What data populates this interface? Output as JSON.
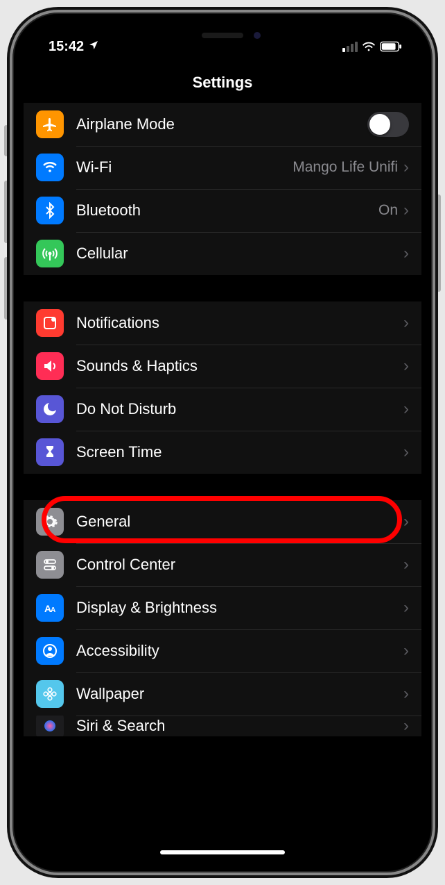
{
  "status": {
    "time": "15:42",
    "location_active": true,
    "cell_bars": 1,
    "wifi": true,
    "battery_pct": 85
  },
  "nav": {
    "title": "Settings"
  },
  "groups": [
    {
      "rows": [
        {
          "id": "airplane-mode",
          "icon": "airplane",
          "icon_bg": "#ff9500",
          "label": "Airplane Mode",
          "type": "toggle",
          "toggle_on": false
        },
        {
          "id": "wifi",
          "icon": "wifi",
          "icon_bg": "#007aff",
          "label": "Wi-Fi",
          "type": "nav",
          "value": "Mango Life Unifi"
        },
        {
          "id": "bluetooth",
          "icon": "bluetooth",
          "icon_bg": "#007aff",
          "label": "Bluetooth",
          "type": "nav",
          "value": "On"
        },
        {
          "id": "cellular",
          "icon": "antenna",
          "icon_bg": "#34c759",
          "label": "Cellular",
          "type": "nav"
        }
      ]
    },
    {
      "rows": [
        {
          "id": "notifications",
          "icon": "bell",
          "icon_bg": "#ff3b30",
          "label": "Notifications",
          "type": "nav"
        },
        {
          "id": "sounds",
          "icon": "speaker",
          "icon_bg": "#ff2d55",
          "label": "Sounds & Haptics",
          "type": "nav"
        },
        {
          "id": "dnd",
          "icon": "moon",
          "icon_bg": "#5856d6",
          "label": "Do Not Disturb",
          "type": "nav"
        },
        {
          "id": "screentime",
          "icon": "hourglass",
          "icon_bg": "#5856d6",
          "label": "Screen Time",
          "type": "nav"
        }
      ]
    },
    {
      "rows": [
        {
          "id": "general",
          "icon": "gear",
          "icon_bg": "#8e8e93",
          "label": "General",
          "type": "nav",
          "highlighted": true
        },
        {
          "id": "control-center",
          "icon": "switches",
          "icon_bg": "#8e8e93",
          "label": "Control Center",
          "type": "nav"
        },
        {
          "id": "display",
          "icon": "aa",
          "icon_bg": "#007aff",
          "label": "Display & Brightness",
          "type": "nav"
        },
        {
          "id": "accessibility",
          "icon": "person",
          "icon_bg": "#007aff",
          "label": "Accessibility",
          "type": "nav"
        },
        {
          "id": "wallpaper",
          "icon": "flower",
          "icon_bg": "#54c7ec",
          "label": "Wallpaper",
          "type": "nav"
        },
        {
          "id": "siri",
          "icon": "siri",
          "icon_bg": "#1c1c1e",
          "label": "Siri & Search",
          "type": "nav",
          "cut": true
        }
      ]
    }
  ]
}
